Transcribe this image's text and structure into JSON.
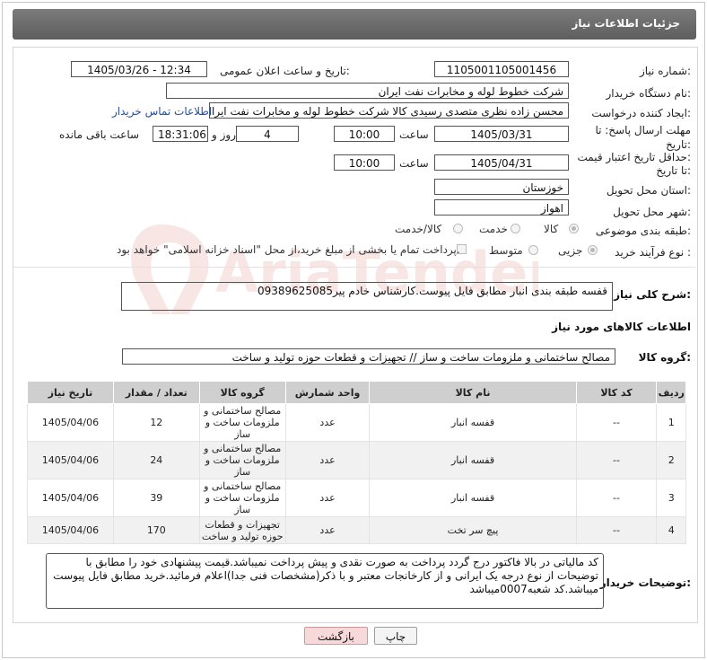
{
  "header": {
    "title": "جزئیات اطلاعات نیاز"
  },
  "form": {
    "need_number_label": "شماره نیاز:",
    "need_number": "1105001105001456",
    "announce_label": "تاریخ و ساعت اعلان عمومی:",
    "announce_value": "1405/03/26 - 12:34",
    "buyer_org_label": "نام دستگاه خریدار:",
    "buyer_org": "شرکت خطوط لوله و مخابرات نفت ایران",
    "requester_label": "ایجاد کننده درخواست:",
    "requester": "محسن زاده نظری متصدی رسیدی کالا شرکت خطوط لوله و مخابرات نفت ایران",
    "contact_link": "اطلاعات تماس خریدار",
    "deadline_label_1": "مهلت ارسال پاسخ: تا",
    "deadline_label_2": "تاریخ:",
    "deadline_date": "1405/03/31",
    "time_label": "ساعت",
    "deadline_time": "10:00",
    "days_value": "4",
    "days_label": "روز و",
    "remaining_time": "18:31:06",
    "remaining_label": "ساعت باقی مانده",
    "price_validity_label_1": "حداقل تاریخ اعتبار قیمت:",
    "price_validity_label_2": "تا تاریخ:",
    "price_validity_date": "1405/04/31",
    "price_validity_time": "10:00",
    "province_label": "استان محل تحویل:",
    "province": "خوزستان",
    "city_label": "شهر محل تحویل:",
    "city": "اهواز",
    "category_label": "طبقه بندی موضوعی:",
    "category_options": [
      "کالا",
      "خدمت",
      "کالا/خدمت"
    ],
    "process_label": "نوع فرآیند خرید :",
    "process_options": [
      "جزیی",
      "متوسط"
    ],
    "payment_note": "پرداخت تمام یا بخشی از مبلغ خرید،از محل \"اسناد خزانه اسلامی\" خواهد بود."
  },
  "description": {
    "label": "شرح کلی نیاز:",
    "text": "قفسه طبقه بندی انبار مطابق فایل پیوست.کارشناس خادم پیر09389625085"
  },
  "goods": {
    "section_title": "اطلاعات کالاهای مورد نیاز",
    "group_label": "گروه کالا:",
    "group_value": "مصالح ساختمانی و ملزومات ساخت و ساز // تجهیزات و قطعات حوزه تولید و ساخت",
    "columns": [
      "ردیف",
      "کد کالا",
      "نام کالا",
      "واحد شمارش",
      "گروه کالا",
      "تعداد / مقدار",
      "تاریخ نیاز"
    ],
    "rows": [
      {
        "idx": "1",
        "code": "--",
        "name": "قفسه انبار",
        "unit": "عدد",
        "group": "مصالح ساختمانی و ملزومات ساخت و ساز",
        "qty": "12",
        "date": "1405/04/06"
      },
      {
        "idx": "2",
        "code": "--",
        "name": "قفسه انبار",
        "unit": "عدد",
        "group": "مصالح ساختمانی و ملزومات ساخت و ساز",
        "qty": "24",
        "date": "1405/04/06"
      },
      {
        "idx": "3",
        "code": "--",
        "name": "قفسه انبار",
        "unit": "عدد",
        "group": "مصالح ساختمانی و ملزومات ساخت و ساز",
        "qty": "39",
        "date": "1405/04/06"
      },
      {
        "idx": "4",
        "code": "--",
        "name": "پیچ سر تخت",
        "unit": "عدد",
        "group": "تجهیزات و قطعات حوزه تولید و ساخت",
        "qty": "170",
        "date": "1405/04/06"
      }
    ]
  },
  "buyer_notes": {
    "label": "توضیحات خریدار:",
    "text": "کد مالیاتی در بالا فاکتور درج گردد پرداخت به صورت نقدی و پیش پرداخت نمیباشد.قیمت پیشنهادی خود را مطابق با توضیحات از نوع درجه یک ایرانی و از کارخانجات معتبر و با ذکر(مشخصات فنی جدا)اعلام فرمائید.خرید مطابق فایل پیوست میباشد.کد شعبه0007میباشد"
  },
  "buttons": {
    "print": "چاپ",
    "back": "بازگشت"
  },
  "watermark": {
    "text": "AriaTender.neT"
  },
  "colors": {
    "title_bar": "#6b6b6b",
    "link": "#1f4fa8",
    "back_button": "#f7d9d9",
    "watermark": "#c0392b"
  }
}
